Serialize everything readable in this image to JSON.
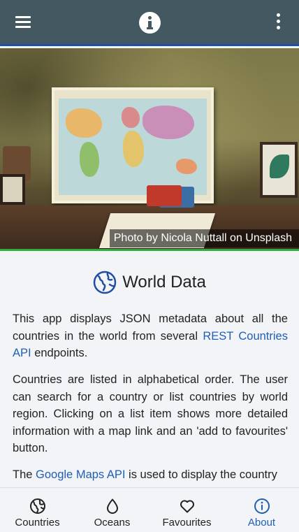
{
  "appbar": {
    "menu_icon": "hamburger-menu-icon",
    "info_icon": "info-icon",
    "more_icon": "more-vertical-icon",
    "background_color": "#445862",
    "underline_color": "#1f4fa3"
  },
  "hero": {
    "caption": "Photo by Nicola Nuttall on Unsplash",
    "underline_color": "#2fae3a"
  },
  "content": {
    "title_icon": "globe-icon",
    "title": "World Data",
    "paragraph1": {
      "before": "This app displays JSON metadata about all the countries in the world from several ",
      "link": "REST Countries API",
      "after": " endpoints."
    },
    "paragraph2": "Countries are listed in alphabetical order. The user can search for a country or list countries by world region. Clicking on a list item shows more detailed information with a map link and an 'add to favourites' button.",
    "paragraph3": {
      "before": "The ",
      "link": "Google Maps API",
      "after": " is used to display the country"
    },
    "link_color": "#1f5fb4"
  },
  "bottom_nav": {
    "tabs": [
      {
        "label": "Countries",
        "icon": "globe-icon",
        "active": false
      },
      {
        "label": "Oceans",
        "icon": "water-drop-icon",
        "active": false
      },
      {
        "label": "Favourites",
        "icon": "heart-icon",
        "active": false
      },
      {
        "label": "About",
        "icon": "info-icon",
        "active": true
      }
    ],
    "active_color": "#1f5fb4"
  }
}
